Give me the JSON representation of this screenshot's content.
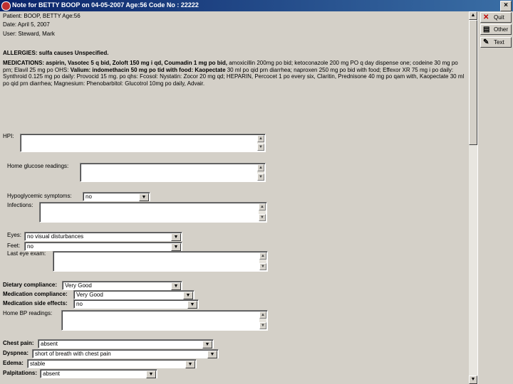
{
  "window": {
    "title": "Note for BETTY BOOP on 04-05-2007 Age:56 Code No : 22222",
    "close_glyph": "×"
  },
  "header": {
    "patient": "Patient: BOOP, BETTY  Age:56",
    "date": "Date: April 5, 2007",
    "user": "User: Steward, Mark",
    "allergies": "ALLERGIES: sulfa causes Unspecified."
  },
  "medications": {
    "p1": "MEDICATIONS: aspirin, ",
    "p2": "Vasotec 5 q bid, Zoloft 150 mg i qd, Coumadin 1 mg po bid, ",
    "p3": "amoxicillin 200mg po bid; ketoconazole 200 mg PO q day dispense one; codeine 30 mg po prn; Elavil 25 mg po OHS: ",
    "p4": "Valium: indomethacin 50 mg po tid with food: Kaopectate ",
    "p5": "30 ml po qid prn diarrhea; naproxen 250 mg po bid with food; Effexor XR 75 mg i po daily: Synthroid 0.125 mg po daily: Provocid 15 mg. po qhs: Fcosol: Nystatin: Zocor 20 mg qd; HEPARIN, Percocet 1 po every six, Claritin, Prednisone 40 mg po qam with, Kaopectate 30 ml po qid prn diarrhea; Magnesium: Phenobarbitol: Glucotrol 10mg po daily, Advair."
  },
  "fields": {
    "hpi": {
      "label": "HPI:"
    },
    "home_glucose": {
      "label": "Home glucose readings:"
    },
    "hypoglycemic": {
      "label": "Hypoglycemic symptoms:",
      "value": "no"
    },
    "infections": {
      "label": "Infections:"
    },
    "eyes": {
      "label": "Eyes:",
      "value": "no visual disturbances"
    },
    "feet": {
      "label": "Feet:",
      "value": "no"
    },
    "last_eye_exam": {
      "label": "Last eye exam:"
    },
    "dietary_compliance": {
      "label": "Dietary compliance:",
      "value": "Very Good"
    },
    "medication_compliance": {
      "label": "Medication compliance:",
      "value": "Very Good"
    },
    "medication_side_effects": {
      "label": "Medication side effects:",
      "value": "no"
    },
    "home_bp": {
      "label": "Home BP readings:"
    },
    "chest_pain": {
      "label": "Chest pain:",
      "value": "absent"
    },
    "dyspnea": {
      "label": "Dyspnea:",
      "value": "short of breath with chest pain"
    },
    "edema": {
      "label": "Edema:",
      "value": "stable"
    },
    "palpitations": {
      "label": "Palpitations:",
      "value": "absent"
    }
  },
  "toolbar": {
    "quit": {
      "label": "Quit",
      "icon": "x-icon"
    },
    "other": {
      "label": "Other",
      "icon": "other-icon"
    },
    "text": {
      "label": "Text",
      "icon": "text-icon"
    }
  },
  "scrollbar": {
    "up_glyph": "▲",
    "down_glyph": "▼"
  },
  "glyphs": {
    "dropdown": "▼",
    "up": "▲",
    "down": "▼"
  },
  "colors": {
    "titlebar": "#0a246a",
    "window": "#d4d0c8",
    "quit_icon": "#c00000"
  }
}
